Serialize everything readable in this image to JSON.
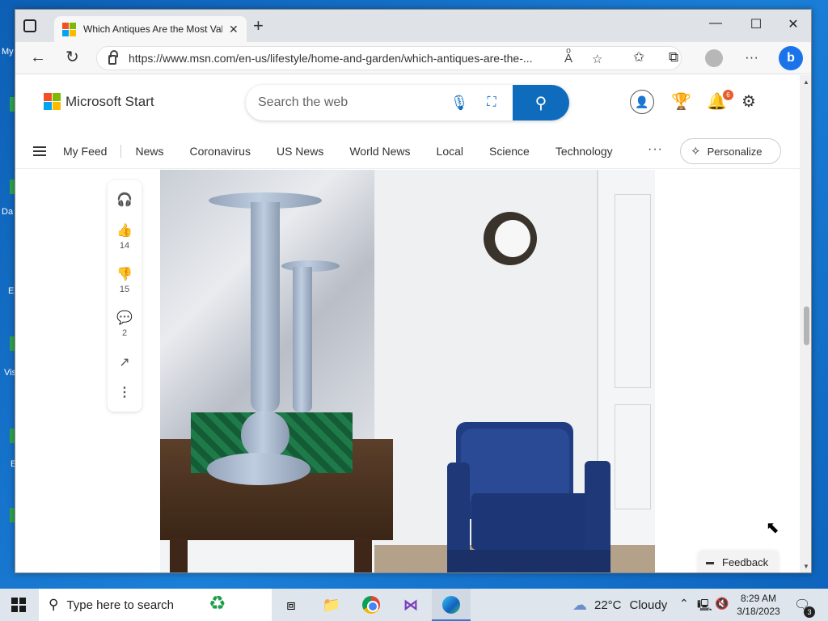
{
  "browser": {
    "tab_title": "Which Antiques Are the Most Valuable",
    "new_tab_icon": "+",
    "url": "https://www.msn.com/en-us/lifestyle/home-and-garden/which-antiques-are-the-..."
  },
  "msn": {
    "brand": "Microsoft Start",
    "search_placeholder": "Search the web",
    "notification_count": "6",
    "nav": [
      "My Feed",
      "News",
      "Coronavirus",
      "US News",
      "World News",
      "Local",
      "Science",
      "Technology"
    ],
    "more": "···",
    "personalize_label": "Personalize"
  },
  "article_rail": {
    "likes": "14",
    "dislikes": "15",
    "comments": "2"
  },
  "feedback_label": "Feedback",
  "desktop_icons": [
    "My",
    "Da",
    "E",
    "Vis",
    "E"
  ],
  "taskbar": {
    "search_text": "Type here to search",
    "temperature": "22°C",
    "weather": "Cloudy",
    "time": "8:29 AM",
    "date": "3/18/2023",
    "notification_count": "3"
  },
  "colors": {
    "accent": "#0f6cbd",
    "ms_red": "#f25022",
    "ms_green": "#7fba00",
    "ms_blue": "#00a4ef",
    "ms_yellow": "#ffb900"
  }
}
